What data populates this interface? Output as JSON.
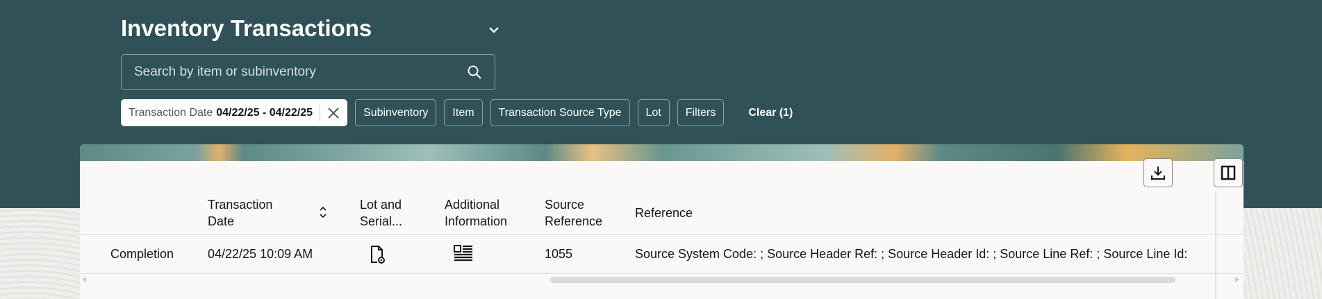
{
  "header": {
    "title": "Inventory Transactions"
  },
  "search": {
    "placeholder": "Search by item or subinventory"
  },
  "filters": {
    "selected": {
      "label": "Transaction Date",
      "value": "04/22/25 - 04/22/25"
    },
    "chips": [
      "Subinventory",
      "Item",
      "Transaction Source Type",
      "Lot",
      "Filters"
    ],
    "clear": "Clear (1)"
  },
  "table": {
    "columns": [
      "",
      "Transaction Date",
      "Lot and Serial...",
      "Additional Information",
      "Source Reference",
      "Reference"
    ],
    "rows": [
      {
        "type": "Completion",
        "date": "04/22/25 10:09 AM",
        "source_ref": "1055",
        "reference": "Source System Code: ; Source Header Ref: ; Source Header Id: ; Source Line Ref: ; Source Line Id:"
      }
    ]
  }
}
